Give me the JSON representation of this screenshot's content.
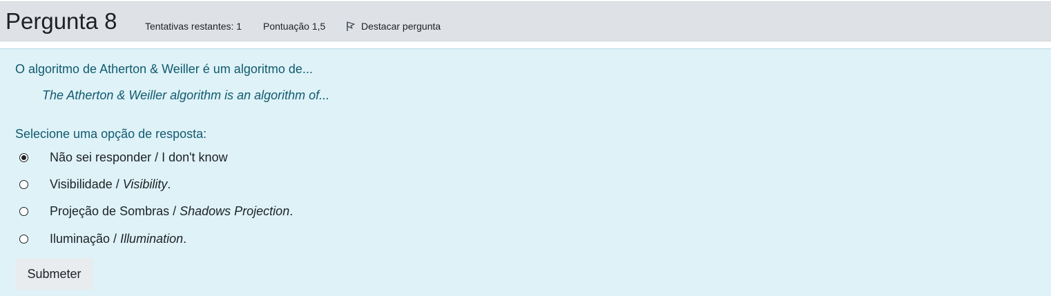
{
  "header": {
    "title": "Pergunta 8",
    "attempts": "Tentativas restantes: 1",
    "score": "Pontuação 1,5",
    "flag_label": "Destacar pergunta",
    "flag_icon": "flag-icon"
  },
  "question": {
    "text": "O algoritmo de Atherton & Weiller é um algoritmo de...",
    "text_en": "The Atherton & Weiller algorithm is an algorithm of...",
    "prompt": "Selecione uma opção de resposta:",
    "options": [
      {
        "pt": "Não sei responder / I don't know",
        "en": "",
        "suffix": "",
        "selected": true
      },
      {
        "pt": "Visibilidade / ",
        "en": "Visibility",
        "suffix": ".",
        "selected": false
      },
      {
        "pt": "Projeção de Sombras / ",
        "en": "Shadows Projection",
        "suffix": ".",
        "selected": false
      },
      {
        "pt": "Iluminação / ",
        "en": "Illumination",
        "suffix": ".",
        "selected": false
      }
    ]
  },
  "submit_label": "Submeter",
  "colors": {
    "header_bg": "#dee2e6",
    "content_bg": "#def2f8",
    "question_text": "#115a6e",
    "button_bg": "#e9ecef"
  }
}
